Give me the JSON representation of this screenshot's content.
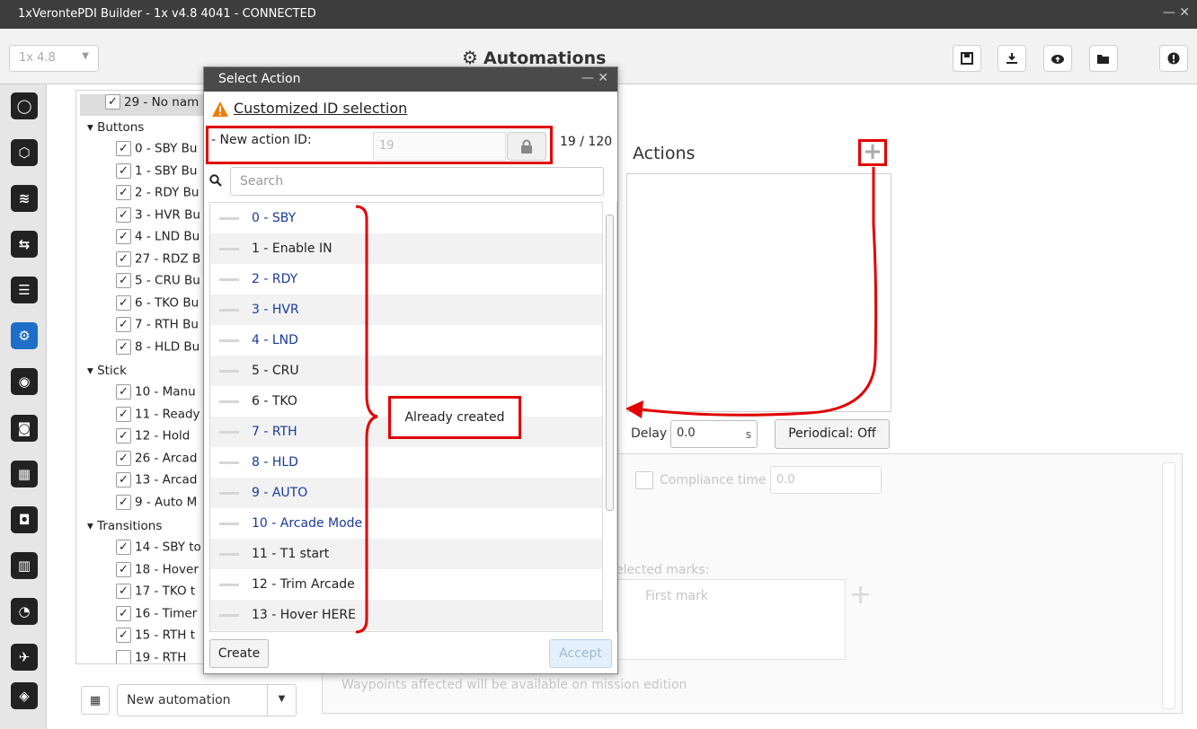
{
  "window": {
    "title": "1xVerontePDI Builder - 1x v4.8 4041 - CONNECTED",
    "controls": "— ✕"
  },
  "header": {
    "version_select": "1x 4.8",
    "page_title": "Automations",
    "toolbar_icons": [
      "save-icon",
      "download-icon",
      "cloud-upload-icon",
      "folder-open-icon",
      "info-icon"
    ]
  },
  "leftnav": {
    "items": [
      "power-icon",
      "polygon-icon",
      "signal-icon",
      "usb-icon",
      "sliders-icon",
      "gears-icon",
      "broadcast-icon",
      "gamepad-icon",
      "keypad-icon",
      "camera-icon",
      "chart-icon",
      "gauge-icon",
      "plane-icon",
      "shield-icon"
    ],
    "active_index": 5
  },
  "tree": {
    "selected": "29 - No nam",
    "groups": [
      {
        "label": "Buttons",
        "items": [
          "0 - SBY Bu",
          "1 - SBY Bu",
          "2 - RDY Bu",
          "3 - HVR Bu",
          "4 - LND Bu",
          "27 - RDZ B",
          "5 - CRU Bu",
          "6 - TKO Bu",
          "7 - RTH Bu",
          "8 - HLD Bu"
        ]
      },
      {
        "label": "Stick",
        "items": [
          "10 - Manu",
          "11 - Ready",
          "12 - Hold",
          "26 - Arcad",
          "13 - Arcad",
          "9 - Auto M"
        ]
      },
      {
        "label": "Transitions",
        "items": [
          "14 - SBY to",
          "18 - Hover",
          "17 - TKO t",
          "16 - Timer",
          "15 - RTH t",
          "19 - RTH"
        ]
      }
    ],
    "new_automation": "New automation"
  },
  "main": {
    "actions_title": "Actions",
    "delay_label": "Delay",
    "delay_value": "0.0",
    "delay_unit": "s",
    "periodical": "Periodical: Off",
    "compliance_label": "Compliance time",
    "compliance_value": "0.0",
    "marks_label": "elected marks:",
    "first_mark": "First mark",
    "waypoints_note": "Waypoints affected will be available on mission edition"
  },
  "modal": {
    "title": "Select Action",
    "controls": "— ✕",
    "custom_id_link": "Customized ID selection",
    "new_action_label": "- New action ID:",
    "new_action_value": "19",
    "count": "19 / 120",
    "search_placeholder": "Search",
    "actions": [
      {
        "label": "0 - SBY",
        "color": "blue"
      },
      {
        "label": "1 - Enable IN",
        "color": "dark"
      },
      {
        "label": "2 - RDY",
        "color": "blue"
      },
      {
        "label": "3 - HVR",
        "color": "blue"
      },
      {
        "label": "4 - LND",
        "color": "blue"
      },
      {
        "label": "5 - CRU",
        "color": "dark"
      },
      {
        "label": "6 - TKO",
        "color": "dark"
      },
      {
        "label": "7 - RTH",
        "color": "blue"
      },
      {
        "label": "8 - HLD",
        "color": "blue"
      },
      {
        "label": "9 - AUTO",
        "color": "blue"
      },
      {
        "label": "10 - Arcade Mode",
        "color": "blue"
      },
      {
        "label": "11 - T1 start",
        "color": "dark"
      },
      {
        "label": "12 - Trim Arcade",
        "color": "dark"
      },
      {
        "label": "13 - Hover HERE",
        "color": "dark"
      }
    ],
    "create_label": "Create",
    "accept_label": "Accept"
  },
  "annotations": {
    "already_created": "Already created",
    "highlight_color": "#e20000"
  }
}
